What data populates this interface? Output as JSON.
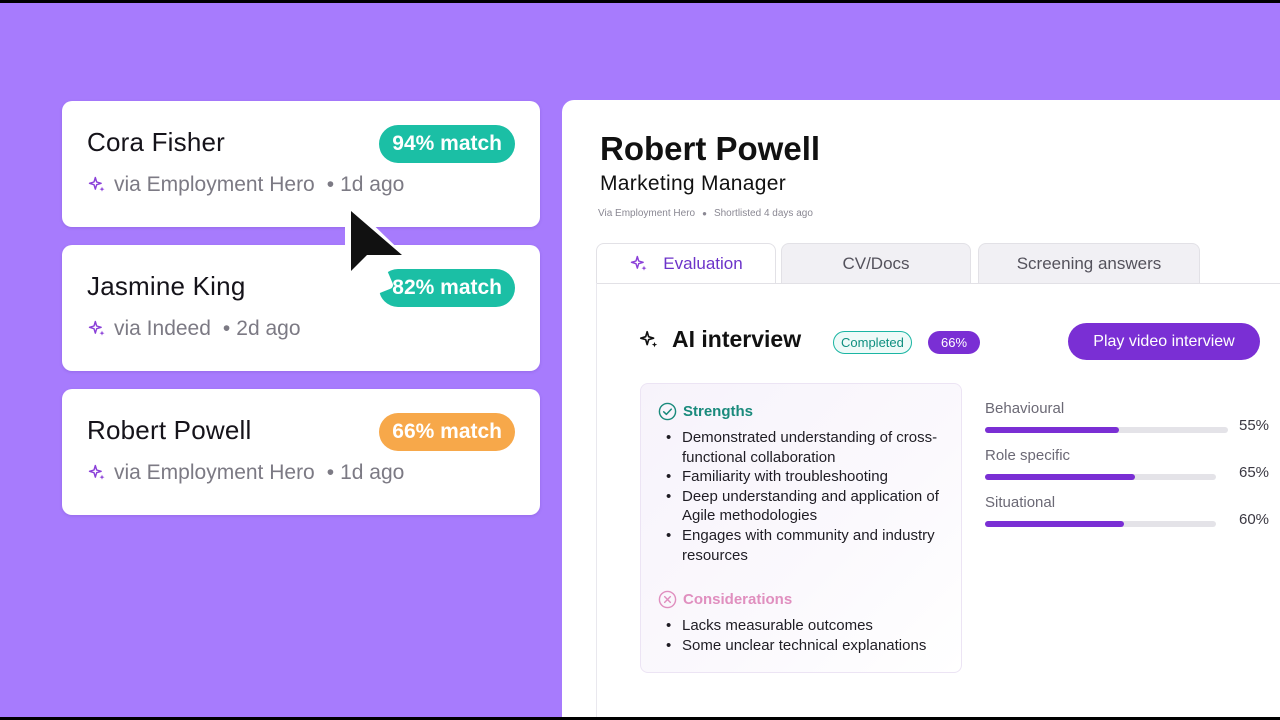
{
  "candidates": [
    {
      "name": "Cora Fisher",
      "match": "94% match",
      "source": "via Employment Hero",
      "time": "1d ago",
      "badge_color": "#1bbfa5"
    },
    {
      "name": "Jasmine King",
      "match": "82% match",
      "source": "via Indeed",
      "time": "2d ago",
      "badge_color": "#1bbfa5"
    },
    {
      "name": "Robert Powell",
      "match": "66% match",
      "source": "via Employment Hero",
      "time": "1d ago",
      "badge_color": "#f7a84a"
    }
  ],
  "detail": {
    "name": "Robert Powell",
    "role": "Marketing Manager",
    "source": "Via Employment Hero",
    "shortlisted": "Shortlisted 4 days ago",
    "tabs": [
      "Evaluation",
      "CV/Docs",
      "Screening answers"
    ],
    "active_tab": "Evaluation",
    "ai_interview": {
      "title": "AI interview",
      "status": "Completed",
      "score": "66%",
      "play_button": "Play video interview"
    },
    "strengths": {
      "heading": "Strengths",
      "items": [
        "Demonstrated understanding of cross-functional collaboration",
        "Familiarity with troubleshooting",
        "Deep understanding and application of Agile methodologies",
        "Engages with community and industry resources"
      ]
    },
    "considerations": {
      "heading": "Considerations",
      "items": [
        "Lacks measurable outcomes",
        "Some unclear technical explanations"
      ]
    },
    "scores": [
      {
        "label": "Behavioural",
        "value": 55,
        "display": "55%"
      },
      {
        "label": "Role specific",
        "value": 65,
        "display": "65%"
      },
      {
        "label": "Situational",
        "value": 60,
        "display": "60%"
      }
    ]
  },
  "colors": {
    "background": "#a77bfd",
    "accent": "#7a2fd4",
    "match_high": "#1bbfa5",
    "match_medium": "#f7a84a",
    "strengths": "#1a8a7c",
    "considerations": "#e08fbf"
  },
  "icons": [
    "sparkle-icon",
    "check-circle-icon",
    "x-circle-icon",
    "cursor-arrow-icon"
  ]
}
